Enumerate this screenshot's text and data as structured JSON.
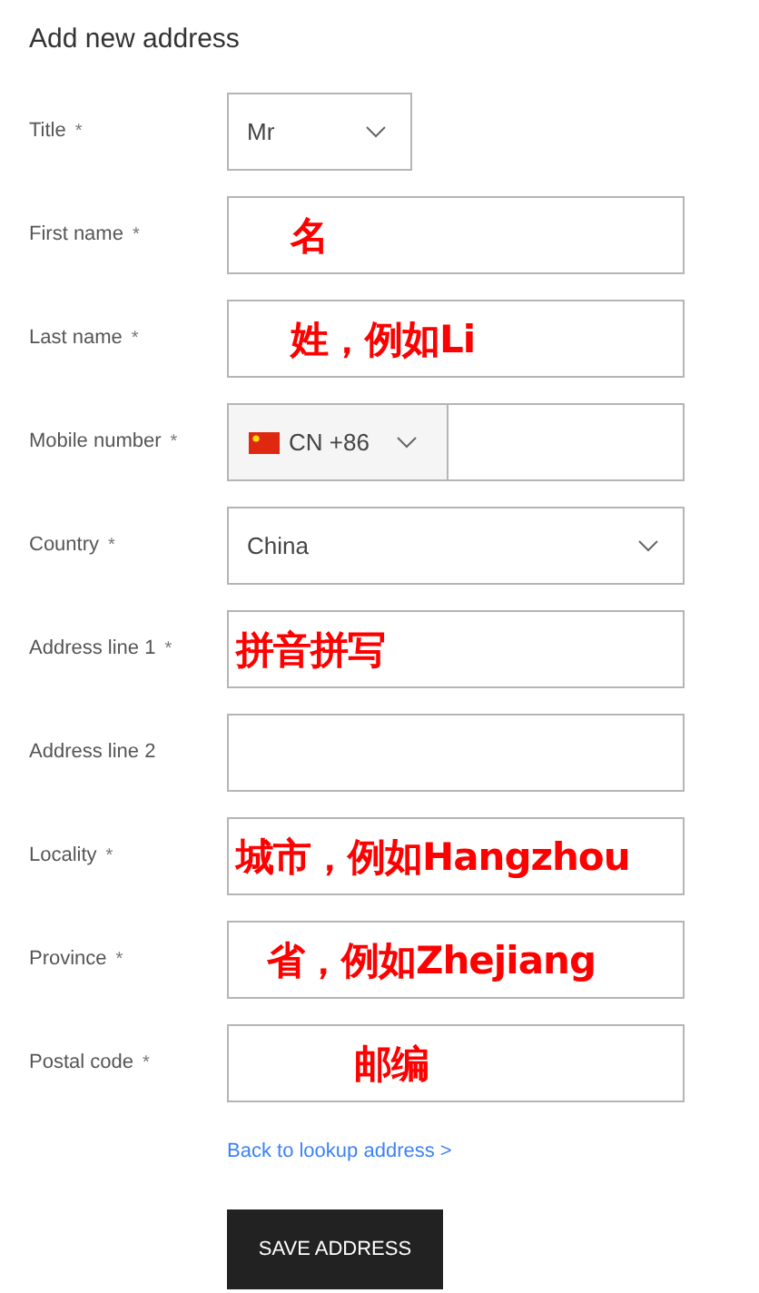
{
  "heading": "Add new address",
  "fields": [
    {
      "kind": "short-select",
      "label": "Title",
      "mark": "*",
      "value": "Mr"
    },
    {
      "kind": "text",
      "label": "First name",
      "mark": "*",
      "annotation": "名"
    },
    {
      "kind": "text",
      "label": "Last name",
      "mark": "*",
      "annotation": "姓，例如Li"
    },
    {
      "kind": "phone",
      "label": "Mobile number",
      "mark": "*",
      "value": "CN +86"
    },
    {
      "kind": "select",
      "label": "Country",
      "mark": "*",
      "value": "China"
    },
    {
      "kind": "text",
      "label": "Address line 1",
      "mark": "*",
      "annotation": "拼音拼写"
    },
    {
      "kind": "text",
      "label": "Address line 2"
    },
    {
      "kind": "text",
      "label": "Locality",
      "mark": "*",
      "annotation": "城市，例如Hangzhou"
    },
    {
      "kind": "text",
      "label": "Province",
      "mark": "*",
      "annotation": "省，例如Zhejiang"
    },
    {
      "kind": "text",
      "label": "Postal code",
      "mark": "*",
      "annotation": "邮编"
    }
  ],
  "link": "Back to lookup address >",
  "button": "SAVE ADDRESS"
}
